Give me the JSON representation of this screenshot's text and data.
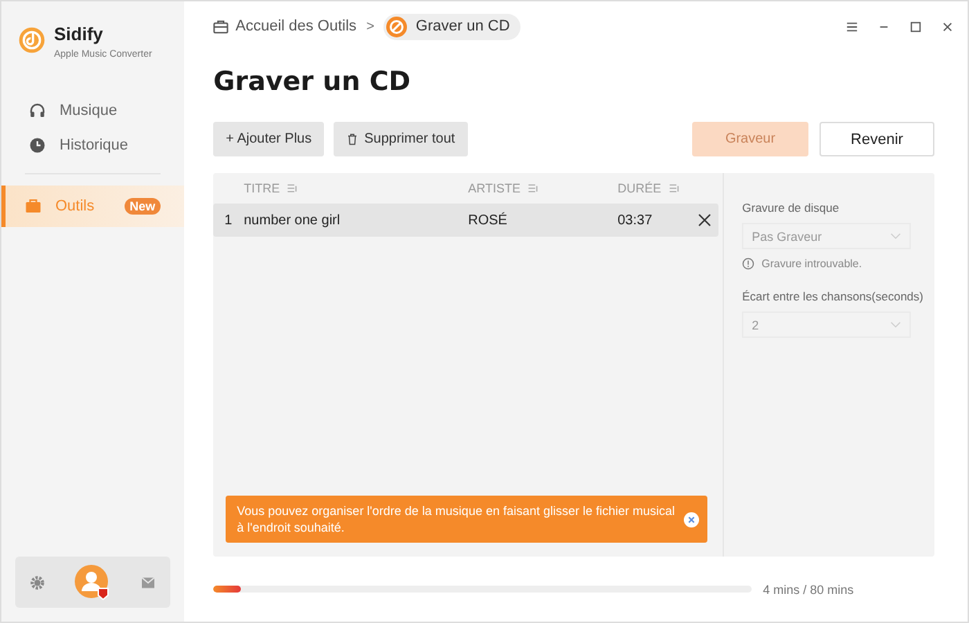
{
  "app": {
    "name": "Sidify",
    "subtitle": "Apple Music Converter"
  },
  "sidebar": {
    "items": [
      {
        "label": "Musique",
        "kind": "headphones",
        "selected": false
      },
      {
        "label": "Historique",
        "kind": "clock",
        "selected": false
      },
      {
        "label": "Outils",
        "kind": "toolbox",
        "selected": true,
        "badge": "New"
      }
    ]
  },
  "breadcrumb": {
    "home": "Accueil des Outils",
    "separator": ">",
    "current": "Graver un CD"
  },
  "title": "Graver un CD",
  "toolbar": {
    "add": "+ Ajouter Plus",
    "clear": "Supprimer tout",
    "burn": {
      "label": "Graveur",
      "disabled": true
    },
    "back": "Revenir"
  },
  "table": {
    "columns": [
      "TITRE",
      "ARTISTE",
      "DURÉE"
    ],
    "rows": [
      {
        "index": "1",
        "title": "number one girl",
        "artist": "ROSÉ",
        "duration": "03:37",
        "selected": true
      }
    ]
  },
  "settings": {
    "burner_label": "Gravure de disque",
    "burner_value": "Pas Graveur",
    "warning": "Gravure introuvable.",
    "gap_label": "Écart entre les chansons(seconds)",
    "gap_value": "2"
  },
  "toast": "Vous pouvez organiser l'ordre de la musique en faisant glisser le fichier musical à l'endroit souhaité.",
  "progress": {
    "level": 0.05,
    "reading": "4 mins / 80 mins"
  }
}
